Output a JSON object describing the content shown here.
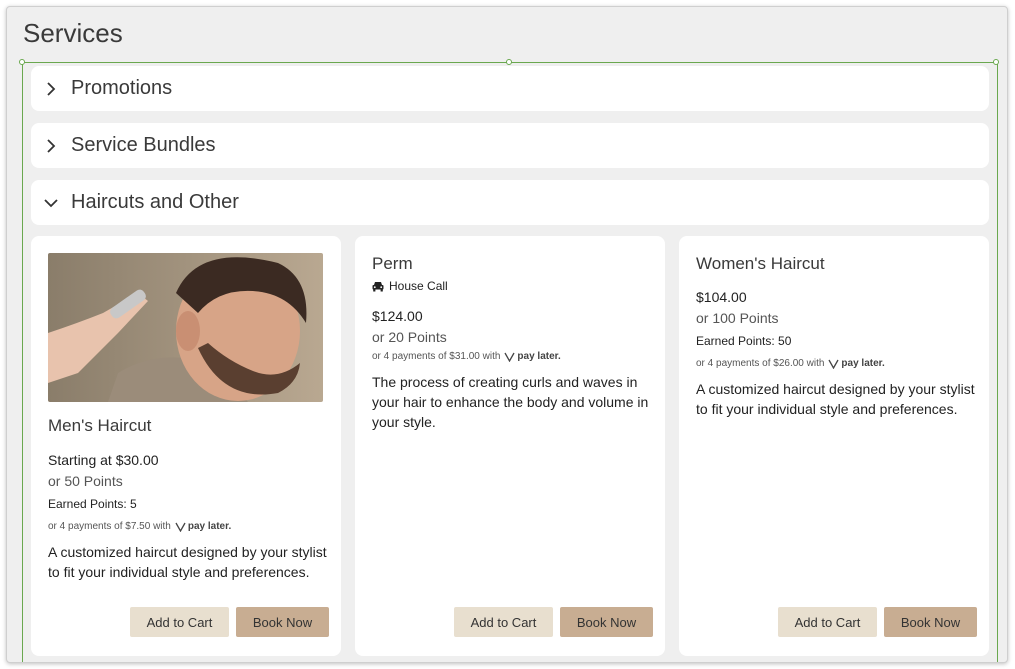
{
  "page": {
    "title": "Services"
  },
  "sections": [
    {
      "label": "Promotions",
      "expanded": false
    },
    {
      "label": "Service Bundles",
      "expanded": false
    },
    {
      "label": "Haircuts and Other",
      "expanded": true
    }
  ],
  "cards": [
    {
      "name": "Men's Haircut",
      "price": "Starting at $30.00",
      "points": "or 50 Points",
      "earned": "Earned Points: 5",
      "paylater": "or 4 payments of $7.50 with",
      "description": "A customized haircut designed by your stylist to fit your individual style and preferences.",
      "add_label": "Add to Cart",
      "book_label": "Book Now"
    },
    {
      "name": "Perm",
      "badge": "House Call",
      "price": "$124.00",
      "points": "or 20 Points",
      "paylater": "or 4 payments of $31.00 with",
      "description": "The process of creating curls and waves in your hair to enhance the body and volume in your style.",
      "add_label": "Add to Cart",
      "book_label": "Book Now"
    },
    {
      "name": "Women's Haircut",
      "price": "$104.00",
      "points": "or 100 Points",
      "earned": "Earned Points: 50",
      "paylater": "or 4 payments of $26.00 with",
      "description": "A customized haircut designed by your stylist to fit your individual style and preferences.",
      "add_label": "Add to Cart",
      "book_label": "Book Now"
    }
  ],
  "paylater_brand": "pay later.",
  "colors": {
    "add_to_cart_bg": "#e8dfcf",
    "book_now_bg": "#c8ad92",
    "selection": "#6aa84f"
  }
}
